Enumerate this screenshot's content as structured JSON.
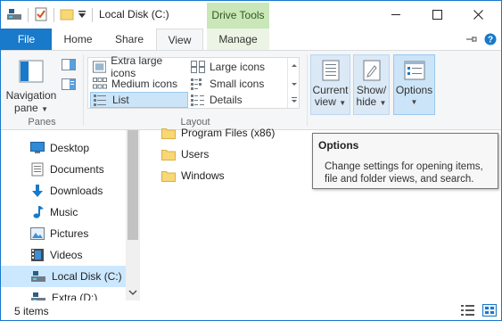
{
  "window": {
    "title": "Local Disk (C:)",
    "context_tab": "Drive Tools"
  },
  "tabs": {
    "file": "File",
    "home": "Home",
    "share": "Share",
    "view": "View",
    "manage": "Manage"
  },
  "ribbon": {
    "panes": {
      "navigation_pane_line1": "Navigation",
      "navigation_pane_line2": "pane",
      "group_label": "Panes"
    },
    "layout": {
      "items": {
        "extra_large_icons": "Extra large icons",
        "large_icons": "Large icons",
        "medium_icons": "Medium icons",
        "small_icons": "Small icons",
        "list": "List",
        "details": "Details"
      },
      "selected": "List",
      "group_label": "Layout"
    },
    "current_view": {
      "line1": "Current",
      "line2": "view"
    },
    "show_hide": {
      "line1": "Show/",
      "line2": "hide"
    },
    "options": {
      "label": "Options"
    }
  },
  "nav_pane": {
    "items": [
      {
        "label": "Desktop",
        "icon": "desktop-icon"
      },
      {
        "label": "Documents",
        "icon": "documents-icon"
      },
      {
        "label": "Downloads",
        "icon": "downloads-icon"
      },
      {
        "label": "Music",
        "icon": "music-icon"
      },
      {
        "label": "Pictures",
        "icon": "pictures-icon"
      },
      {
        "label": "Videos",
        "icon": "videos-icon"
      },
      {
        "label": "Local Disk (C:)",
        "icon": "drive-icon",
        "selected": true
      },
      {
        "label": "Extra (D:)",
        "icon": "drive-icon"
      }
    ]
  },
  "content": {
    "files": [
      {
        "name": "Program Files (x86)"
      },
      {
        "name": "Users"
      },
      {
        "name": "Windows"
      }
    ]
  },
  "tooltip": {
    "title": "Options",
    "description": "Change settings for opening items, file and folder views, and search."
  },
  "status": {
    "item_count": "5 items"
  },
  "colors": {
    "accent": "#1979ca",
    "drive_tools_tab": "#c9e7b9",
    "selection": "#cce8ff",
    "folder": "#f8d775"
  }
}
